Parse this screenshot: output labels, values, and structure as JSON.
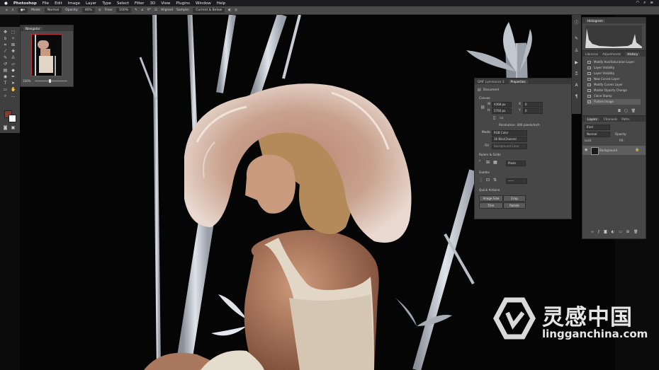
{
  "menubar": {
    "app": "Photoshop",
    "items": [
      "File",
      "Edit",
      "Image",
      "Layer",
      "Type",
      "Select",
      "Filter",
      "3D",
      "View",
      "Plugins",
      "Window",
      "Help"
    ]
  },
  "options_bar": {
    "mode_label": "Mode:",
    "mode_value": "Normal",
    "opacity_label": "Opacity:",
    "opacity_value": "40%",
    "flow_label": "Flow:",
    "flow_value": "100%",
    "angle_value": "0°",
    "aligned_label": "Aligned",
    "sample_label": "Sample:",
    "sample_value": "Current & Below"
  },
  "navigator": {
    "title": "Navigator",
    "zoom": "100%"
  },
  "histogram": {
    "title": "Histogram"
  },
  "history": {
    "tabs": [
      "Libraries",
      "Adjustments",
      "History"
    ],
    "items": [
      "Modify Hue/Saturation Layer",
      "Layer Visibility",
      "Layer Visibility",
      "New Curves Layer",
      "Modify Curves Layer",
      "Master Opacity Change",
      "Clone Stamp",
      "Flatten Image"
    ]
  },
  "properties": {
    "tabs": [
      "GMF Luminance 3",
      "Properties"
    ],
    "document_label": "Document",
    "canvas_section": "Canvas",
    "w_label": "W",
    "w_value": "4368 px",
    "h_label": "H",
    "h_value": "5760 px",
    "x_label": "X",
    "x_value": "0",
    "y_label": "Y",
    "y_value": "0",
    "resolution": "Resolution: 300 pixels/inch",
    "mode_label": "Mode",
    "mode_value": "RGB Color",
    "bit_depth": "16 Bits/Channel",
    "fill_label": "Fill",
    "fill_value": "Background Color",
    "rulers_section": "Rulers & Grids",
    "units_value": "Pixels",
    "guides_section": "Guides",
    "quick_actions_section": "Quick Actions",
    "btn_image_size": "Image Size",
    "btn_crop": "Crop",
    "btn_trim": "Trim",
    "btn_rotate": "Rotate"
  },
  "layers": {
    "tabs": [
      "Layers",
      "Channels",
      "Paths"
    ],
    "kind_label": "Kind",
    "blend_value": "Normal",
    "opacity_label": "Opacity:",
    "lock_label": "Lock:",
    "fill_label": "Fill:",
    "layer_name": "Background"
  },
  "watermark": {
    "cn": "灵感中国",
    "en": "lingganchina.com"
  },
  "colors": {
    "foreground": "#8a3a2a",
    "background": "#ffffff",
    "panel": "#474747",
    "canvas": "#050505"
  }
}
